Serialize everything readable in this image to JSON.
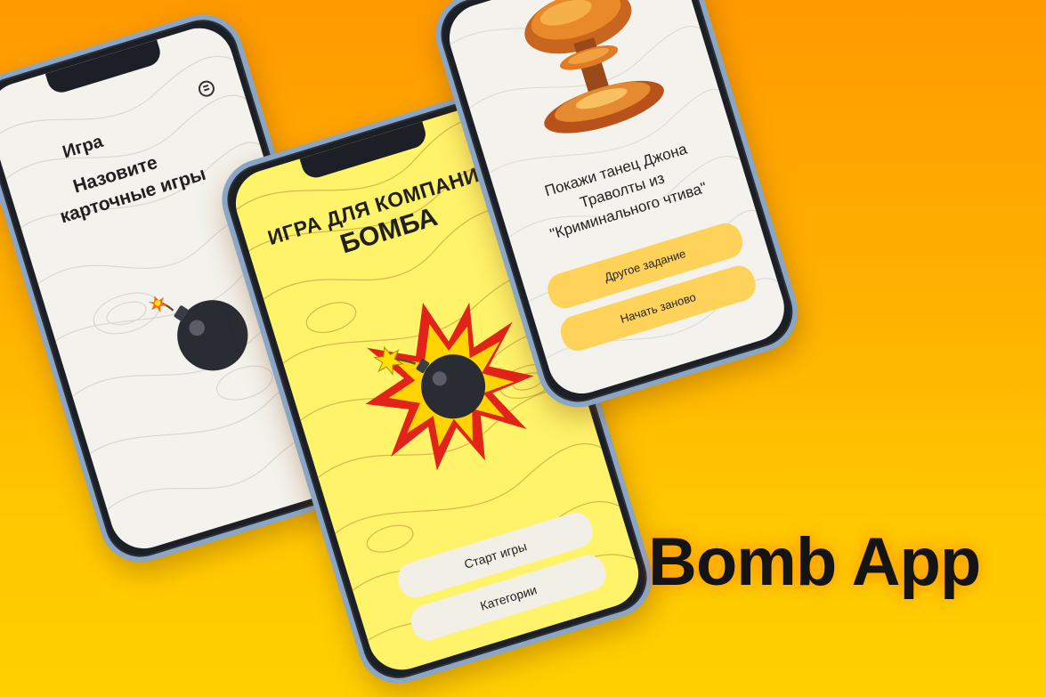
{
  "brand": {
    "name": "Bomb App"
  },
  "colors": {
    "bg_top": "#ff9a00",
    "bg_bottom": "#ffd000",
    "screen_yellow": "#fff36a",
    "button_yellow": "#ffd25a",
    "screen_light": "#f4f2ec"
  },
  "left_phone": {
    "title": "Игра",
    "prompt_line1": "Назовите",
    "prompt_line2": "карточные игры",
    "menu_icon": "settings-icon",
    "bomb_icon": "bomb-icon"
  },
  "center_phone": {
    "title_line1": "ИГРА ДЛЯ КОМПАНИИ",
    "title_line2": "БОМБА",
    "start_button": "Старт игры",
    "categories_button": "Категории",
    "bomb_icon": "bomb-explosion-icon"
  },
  "right_phone": {
    "task_line1": "Покажи танец Джона",
    "task_line2": "Траволты из",
    "task_line3": "\"Криминального чтива\"",
    "other_task_button": "Другое задание",
    "restart_button": "Начать заново",
    "explosion_icon": "mushroom-cloud-icon"
  }
}
